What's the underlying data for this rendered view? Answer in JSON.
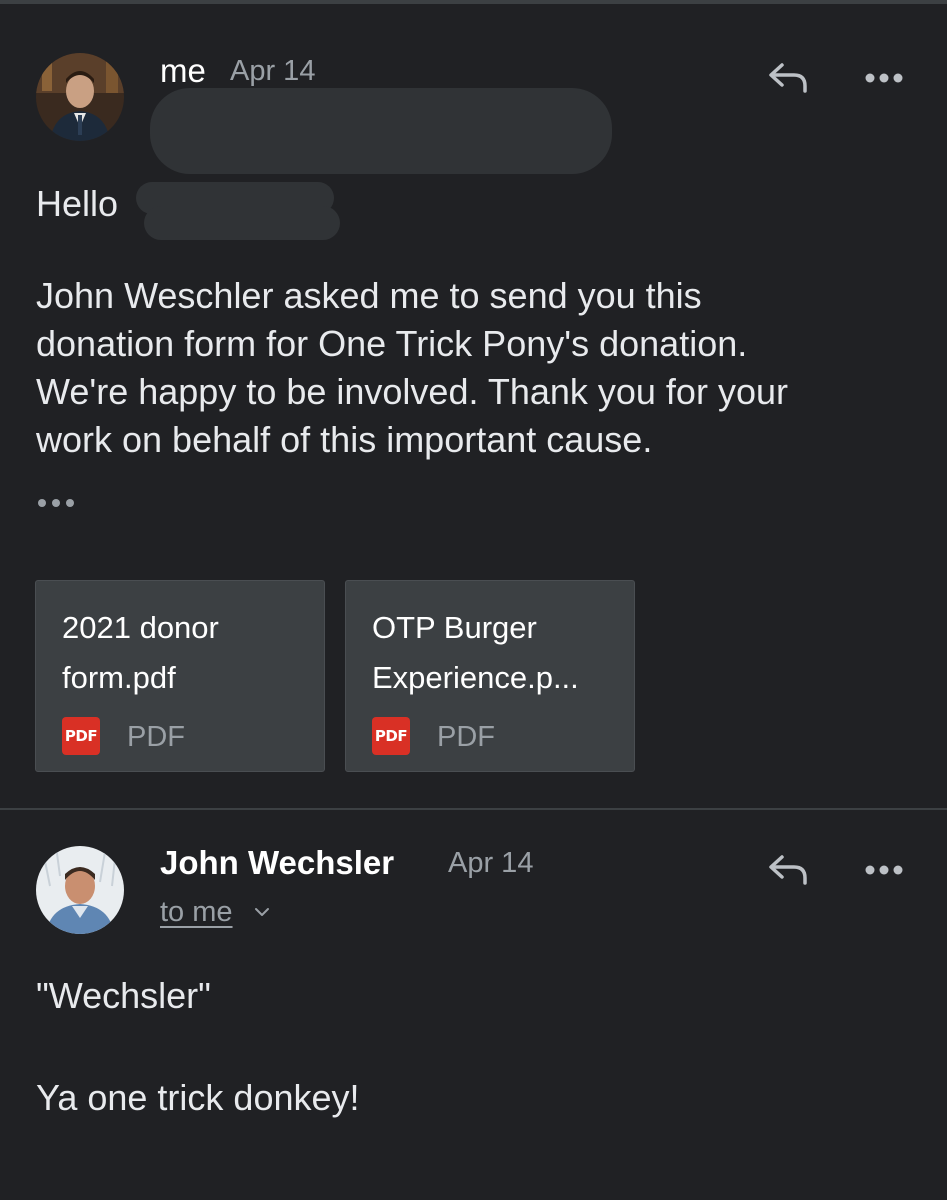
{
  "messages": [
    {
      "sender": "me",
      "date": "Apr 14",
      "greeting": "Hello",
      "body_lines": [
        "John Weschler asked me to send you this",
        "donation form for One Trick Pony's donation.",
        "We're happy to be involved. Thank you for your",
        "work on behalf of this important cause."
      ],
      "attachments": [
        {
          "name": "2021 donor form.pdf",
          "badge": "PDF",
          "type": "PDF"
        },
        {
          "name": "OTP Burger Experience.p...",
          "badge": "PDF",
          "type": "PDF"
        }
      ]
    },
    {
      "sender": "John Wechsler",
      "date": "Apr 14",
      "recipient": "to me",
      "body_lines": [
        "\"Wechsler\"",
        "Ya one trick donkey!"
      ]
    }
  ],
  "icons": {
    "reply": "reply-icon",
    "more": "more-options-icon",
    "expand": "chevron-down-icon",
    "trimmed": "show-trimmed-content-icon"
  },
  "colors": {
    "background": "#202124",
    "text": "#e8eaed",
    "muted": "#9aa0a6",
    "attachment_bg": "#3c4043",
    "pdf_red": "#d93025"
  }
}
